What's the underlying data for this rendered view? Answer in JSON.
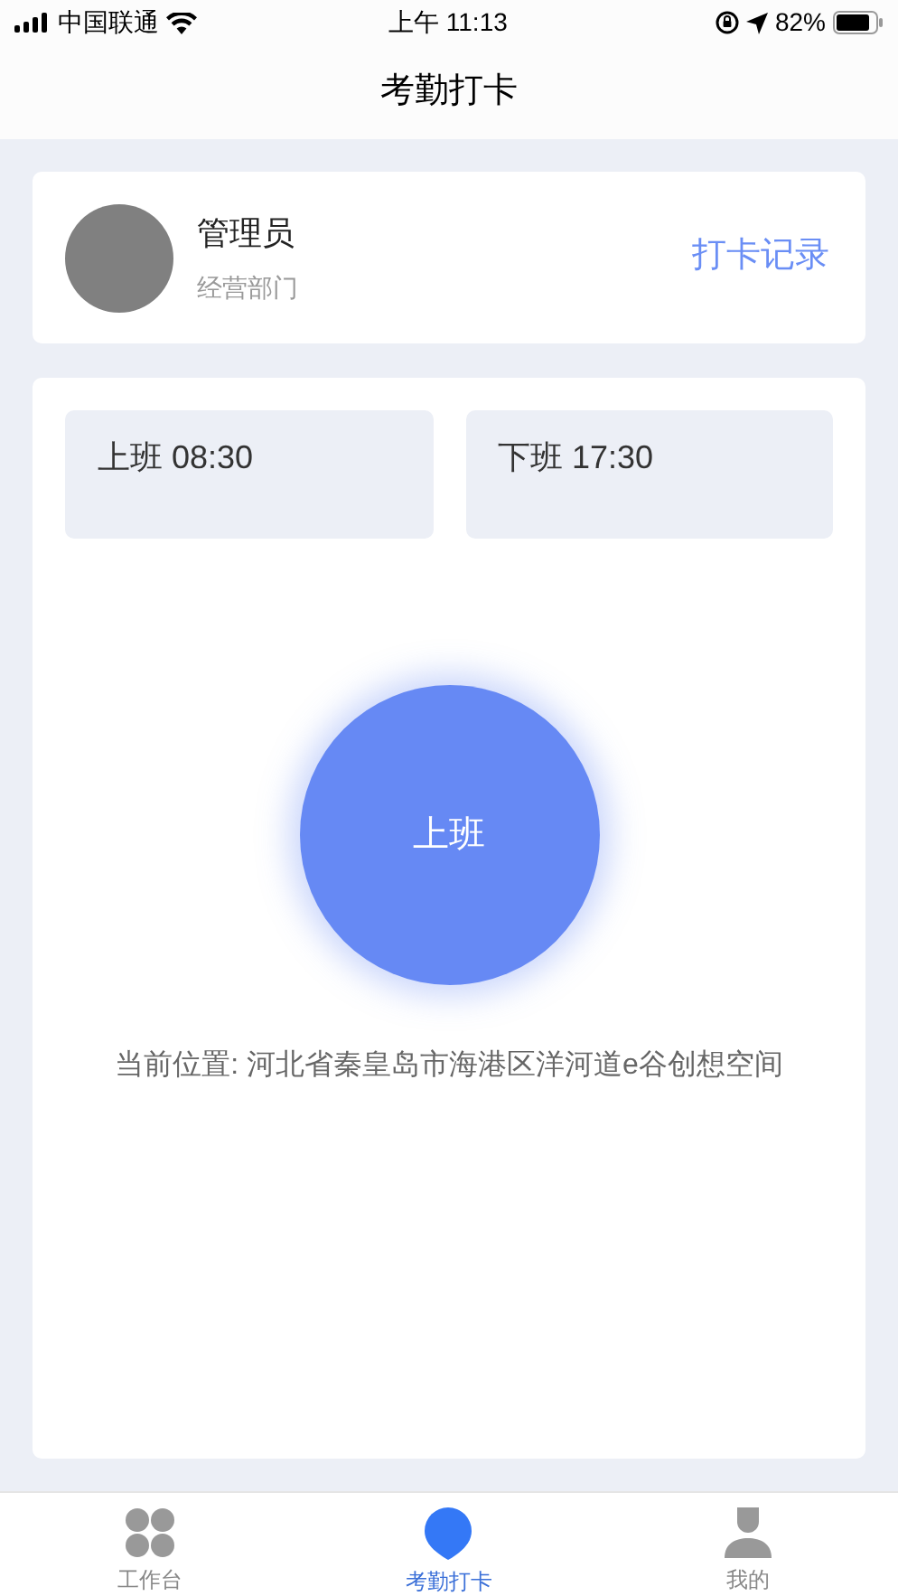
{
  "status_bar": {
    "carrier": "中国联通",
    "time": "上午 11:13",
    "battery": "82%"
  },
  "title": "考勤打卡",
  "profile": {
    "name": "管理员",
    "department": "经营部门",
    "records_link": "打卡记录"
  },
  "shifts": [
    {
      "label": "上班 08:30"
    },
    {
      "label": "下班 17:30"
    }
  ],
  "punch_button": "上班",
  "location": "当前位置: 河北省秦皇岛市海港区洋河道e谷创想空间",
  "tabs": [
    {
      "kind": "workbench",
      "label": "工作台",
      "selected": false
    },
    {
      "kind": "attendance",
      "label": "考勤打卡",
      "selected": true
    },
    {
      "kind": "profile",
      "label": "我的",
      "selected": false
    }
  ]
}
